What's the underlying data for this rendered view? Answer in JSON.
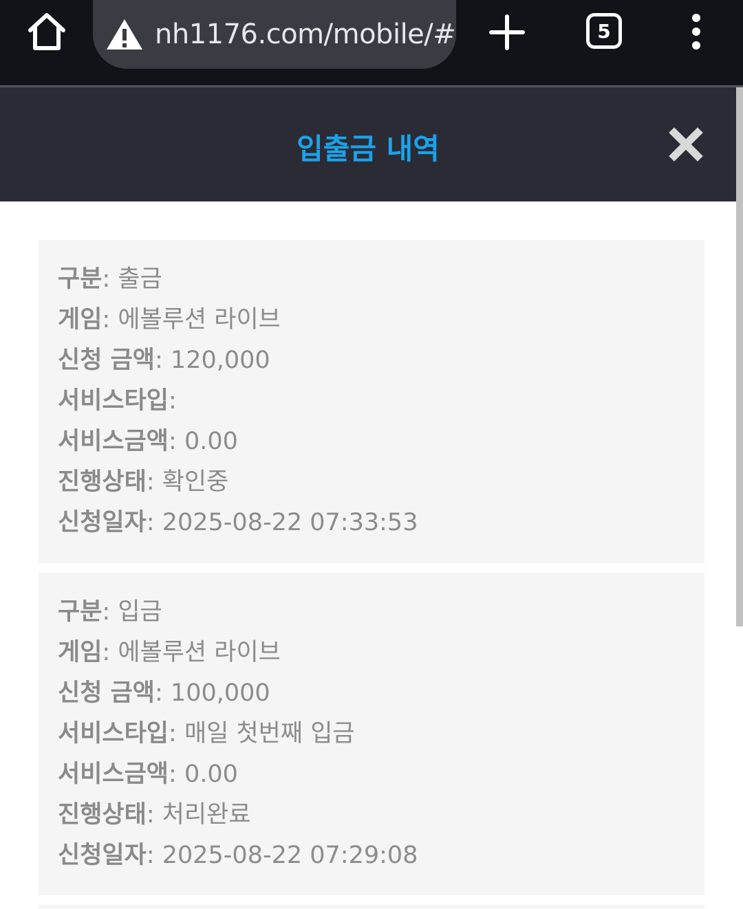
{
  "browser": {
    "url": "nh1176.com/mobile/#",
    "tab_count": "5",
    "icons": [
      "home-icon",
      "warning-icon",
      "plus-icon",
      "tabs-icon",
      "more-vert-icon"
    ]
  },
  "modal": {
    "title": "입출금 내역",
    "close_icon": "close-icon",
    "accent_color": "#1aa3ea"
  },
  "records": [
    {
      "type_label": "구분",
      "type_value": "출금",
      "game_label": "게임",
      "game_value": "에볼루션 라이브",
      "amount_label": "신청 금액",
      "amount_value": "120,000",
      "service_type_label": "서비스타입",
      "service_type_value": "",
      "service_amount_label": "서비스금액",
      "service_amount_value": "0.00",
      "status_label": "진행상태",
      "status_value": "확인중",
      "date_label": "신청일자",
      "date_value": "2025-08-22 07:33:53"
    },
    {
      "type_label": "구분",
      "type_value": "입금",
      "game_label": "게임",
      "game_value": "에볼루션 라이브",
      "amount_label": "신청 금액",
      "amount_value": "100,000",
      "service_type_label": "서비스타입",
      "service_type_value": "매일 첫번째 입금",
      "service_amount_label": "서비스금액",
      "service_amount_value": "0.00",
      "status_label": "진행상태",
      "status_value": "처리완료",
      "date_label": "신청일자",
      "date_value": "2025-08-22 07:29:08"
    }
  ]
}
